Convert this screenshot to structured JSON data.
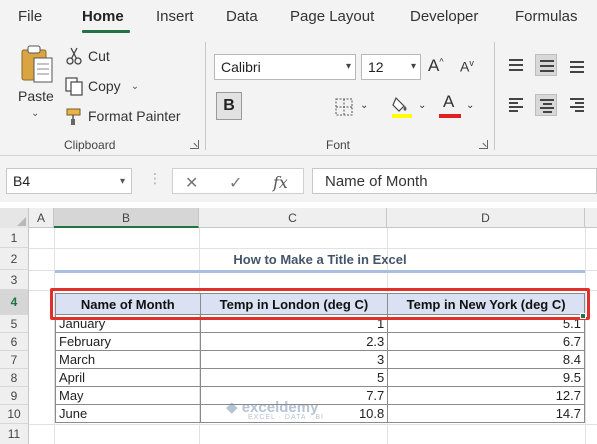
{
  "menu": {
    "tabs": [
      "File",
      "Home",
      "Insert",
      "Data",
      "Page Layout",
      "Developer",
      "Formulas"
    ],
    "active": "Home"
  },
  "ribbon": {
    "clipboard": {
      "paste": "Paste",
      "cut": "Cut",
      "copy": "Copy",
      "format_painter": "Format Painter",
      "label": "Clipboard"
    },
    "font": {
      "family": "Calibri",
      "size": "12",
      "grow": "A",
      "shrink": "A",
      "bold": "B",
      "font_color_letter": "A",
      "label": "Font"
    }
  },
  "formula_bar": {
    "name_box": "B4",
    "cancel": "✕",
    "enter": "✓",
    "fx": "fx",
    "content": "Name of Month"
  },
  "sheet": {
    "columns": [
      "A",
      "B",
      "C",
      "D"
    ],
    "rows": [
      "1",
      "2",
      "3",
      "4",
      "5",
      "6",
      "7",
      "8",
      "9",
      "10",
      "11"
    ],
    "title": "How to Make a Title in Excel",
    "headers": [
      "Name of Month",
      "Temp in London (deg C)",
      "Temp in New York (deg C)"
    ],
    "data": [
      [
        "January",
        "1",
        "5.1"
      ],
      [
        "February",
        "2.3",
        "6.7"
      ],
      [
        "March",
        "3",
        "8.4"
      ],
      [
        "April",
        "5",
        "9.5"
      ],
      [
        "May",
        "7.7",
        "12.7"
      ],
      [
        "June",
        "10.8",
        "14.7"
      ]
    ],
    "watermark": "exceldemy",
    "watermark_sub": "EXCEL · DATA · BI"
  },
  "colors": {
    "accent_green": "#217346",
    "highlight_red": "#e0302b",
    "header_fill": "#d9e1f2",
    "title_text": "#44546a"
  }
}
